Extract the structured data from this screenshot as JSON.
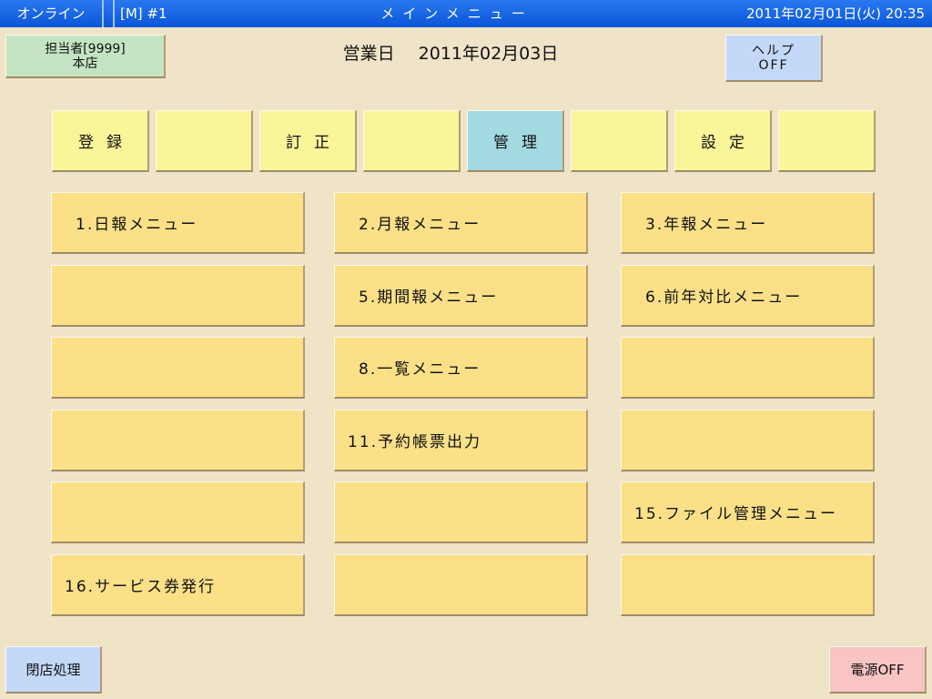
{
  "titlebar": {
    "status": "オンライン",
    "mode": "[M]  #1",
    "title": "メインメニュー",
    "datetime": "2011年02月01日(火) 20:35"
  },
  "header": {
    "staff_line1": "担当者[9999]",
    "staff_line2": "本店",
    "business_day_label": "営業日",
    "business_day": "2011年02月03日",
    "help_line1": "ヘルプ",
    "help_line2": "OFF"
  },
  "tabs": [
    {
      "label": "登録"
    },
    {
      "label": ""
    },
    {
      "label": "訂正"
    },
    {
      "label": ""
    },
    {
      "label": "管理",
      "active": true
    },
    {
      "label": ""
    },
    {
      "label": "設定"
    },
    {
      "label": ""
    }
  ],
  "menu": [
    {
      "label": "1.日報メニュー"
    },
    {
      "label": "2.月報メニュー"
    },
    {
      "label": "3.年報メニュー"
    },
    {
      "label": ""
    },
    {
      "label": "5.期間報メニュー"
    },
    {
      "label": "6.前年対比メニュー"
    },
    {
      "label": ""
    },
    {
      "label": "8.一覧メニュー"
    },
    {
      "label": ""
    },
    {
      "label": ""
    },
    {
      "label": "11.予約帳票出力"
    },
    {
      "label": ""
    },
    {
      "label": ""
    },
    {
      "label": ""
    },
    {
      "label": "15.ファイル管理メニュー"
    },
    {
      "label": "16.サービス券発行"
    },
    {
      "label": ""
    },
    {
      "label": ""
    }
  ],
  "footer": {
    "close_label": "閉店処理",
    "power_label": "電源OFF"
  },
  "colors": {
    "background": "#efe4c8",
    "titlebar": "#0a56d8",
    "tab": "#fbf59a",
    "tab_active": "#a3d9e0",
    "menu_button": "#fbe088",
    "staff_button": "#c4e4c4",
    "help_button": "#c4d8f8",
    "power_button": "#f8c4c4"
  }
}
